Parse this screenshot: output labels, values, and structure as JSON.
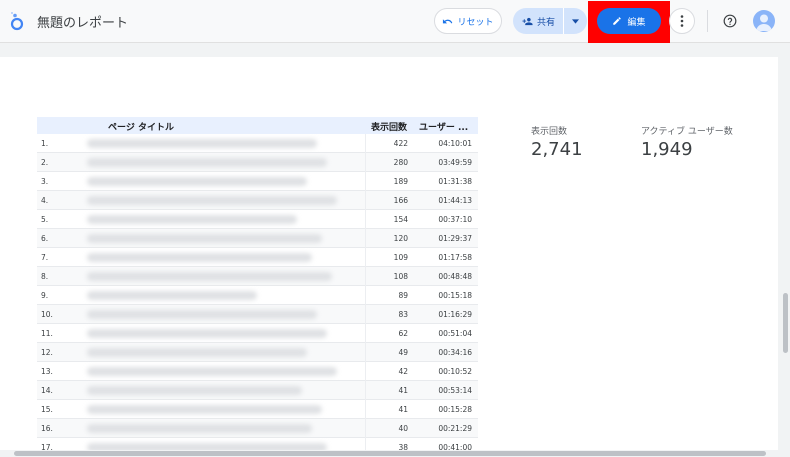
{
  "header": {
    "title": "無題のレポート",
    "reset_label": "リセット",
    "share_label": "共有",
    "edit_label": "編集"
  },
  "table": {
    "headers": {
      "title": "ページ タイトル",
      "views": "表示回数",
      "users": "ユーザー ..."
    },
    "rows": [
      {
        "idx": "1.",
        "views": "422",
        "duration": "04:10:01"
      },
      {
        "idx": "2.",
        "views": "280",
        "duration": "03:49:59"
      },
      {
        "idx": "3.",
        "views": "189",
        "duration": "01:31:38"
      },
      {
        "idx": "4.",
        "views": "166",
        "duration": "01:44:13"
      },
      {
        "idx": "5.",
        "views": "154",
        "duration": "00:37:10"
      },
      {
        "idx": "6.",
        "views": "120",
        "duration": "01:29:37"
      },
      {
        "idx": "7.",
        "views": "109",
        "duration": "01:17:58"
      },
      {
        "idx": "8.",
        "views": "108",
        "duration": "00:48:48"
      },
      {
        "idx": "9.",
        "views": "89",
        "duration": "00:15:18"
      },
      {
        "idx": "10.",
        "views": "83",
        "duration": "01:16:29"
      },
      {
        "idx": "11.",
        "views": "62",
        "duration": "00:51:04"
      },
      {
        "idx": "12.",
        "views": "49",
        "duration": "00:34:16"
      },
      {
        "idx": "13.",
        "views": "42",
        "duration": "00:10:52"
      },
      {
        "idx": "14.",
        "views": "41",
        "duration": "00:53:14"
      },
      {
        "idx": "15.",
        "views": "41",
        "duration": "00:15:28"
      },
      {
        "idx": "16.",
        "views": "40",
        "duration": "00:21:29"
      },
      {
        "idx": "17.",
        "views": "38",
        "duration": "00:41:00"
      }
    ]
  },
  "scorecards": [
    {
      "label": "表示回数",
      "value": "2,741"
    },
    {
      "label": "アクティブ ユーザー数",
      "value": "1,949"
    }
  ],
  "colors": {
    "accent": "#1a73e8",
    "highlight": "#ff0000",
    "share_bg": "#d2e3fc"
  },
  "icons": {
    "logo": "looker-studio-logo-icon",
    "reset": "undo-icon",
    "share": "person-add-icon",
    "edit": "pencil-icon",
    "more": "more-vert-icon",
    "help": "help-icon",
    "avatar": "account-avatar-icon"
  }
}
